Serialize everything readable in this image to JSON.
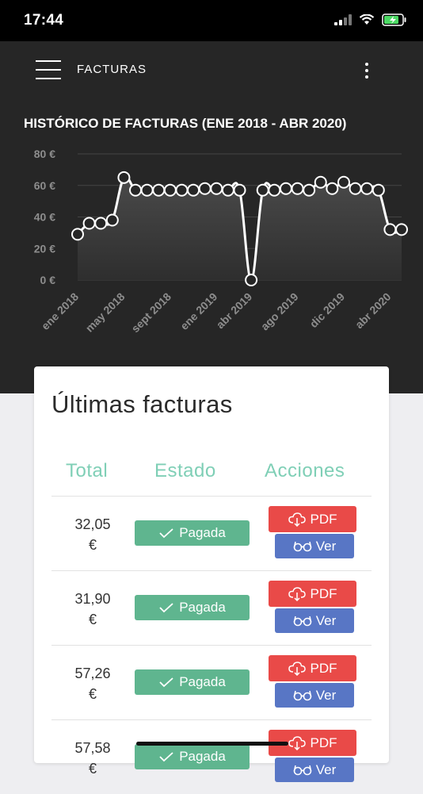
{
  "status": {
    "time": "17:44"
  },
  "appbar": {
    "title": "FACTURAS"
  },
  "chart_data": {
    "type": "area",
    "title": "HISTÓRICO DE FACTURAS (ENE 2018 - ABR 2020)",
    "y_ticks": [
      "80 €",
      "60 €",
      "40 €",
      "20 €",
      "0 €"
    ],
    "ylim": [
      0,
      80
    ],
    "grid": true,
    "x_tick_labels": [
      "ene 2018",
      "may 2018",
      "sept 2018",
      "ene 2019",
      "abr 2019",
      "ago 2019",
      "dic 2019",
      "abr 2020"
    ],
    "x_tick_index": [
      0,
      4,
      8,
      12,
      15,
      19,
      23,
      27
    ],
    "series": [
      {
        "values": [
          29,
          36,
          36,
          38,
          65,
          57,
          57,
          57,
          57,
          57,
          57,
          58,
          58,
          57,
          57,
          0,
          57,
          57,
          58,
          58,
          57,
          62,
          58,
          62,
          58,
          58,
          57,
          32,
          32
        ]
      }
    ],
    "colors": {
      "line": "#ffffff",
      "fill": "#4a4a4a",
      "grid": "#444444",
      "text": "#8d8d8d"
    }
  },
  "card": {
    "title": "Últimas facturas",
    "headers": {
      "total": "Total",
      "estado": "Estado",
      "acciones": "Acciones"
    },
    "rows": [
      {
        "amount": "32,05",
        "currency": "€",
        "status": "Pagada",
        "pdf": "PDF",
        "ver": "Ver"
      },
      {
        "amount": "31,90",
        "currency": "€",
        "status": "Pagada",
        "pdf": "PDF",
        "ver": "Ver"
      },
      {
        "amount": "57,26",
        "currency": "€",
        "status": "Pagada",
        "pdf": "PDF",
        "ver": "Ver"
      },
      {
        "amount": "57,58",
        "currency": "€",
        "status": "Pagada",
        "pdf": "PDF",
        "ver": "Ver"
      }
    ]
  },
  "colors": {
    "paid": "#5fb58f",
    "pdf": "#e94a48",
    "ver": "#5876c5",
    "header_accent": "#7fcfb6"
  }
}
